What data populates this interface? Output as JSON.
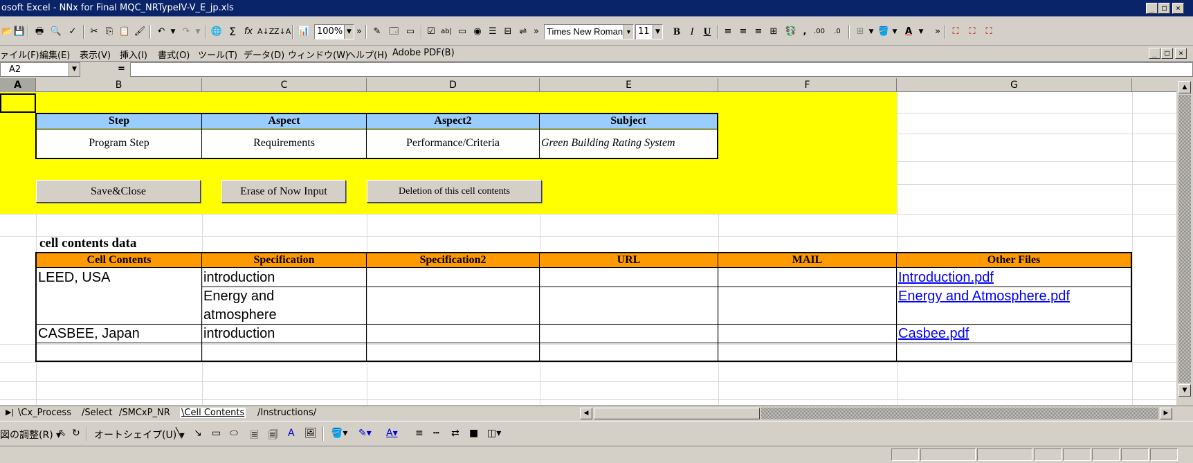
{
  "window": {
    "title": "osoft Excel - NNx for Final MQC_NRTypeIV-V_E_jp.xls",
    "min_label": "_",
    "max_label": "□",
    "close_label": "×"
  },
  "toolbar": {
    "zoom": "100%",
    "font_name": "Times New Roman",
    "font_size": "11",
    "bold": "B",
    "italic": "I",
    "underline": "U",
    "comma": ",",
    "inc_decimal": ".00",
    "dec_decimal": ".0",
    "sum": "Σ",
    "fx": "fx",
    "overflow": "»"
  },
  "menu": [
    "ァイル(F)",
    "編集(E)",
    "表示(V)",
    "挿入(I)",
    "書式(O)",
    "ツール(T)",
    "データ(D)",
    "ウィンドウ(W)",
    "ヘルプ(H)",
    "Adobe PDF(B)"
  ],
  "formula": {
    "cell_ref": "A2",
    "equals": "=",
    "value": ""
  },
  "columns": [
    "A",
    "B",
    "C",
    "D",
    "E",
    "F",
    "G"
  ],
  "header_table": {
    "headers": [
      "Step",
      "Aspect",
      "Aspect2",
      "Subject"
    ],
    "values": [
      "Program Step",
      "Requirements",
      "Performance/Criteria",
      "Green Building Rating System"
    ]
  },
  "buttons": {
    "save_close": "Save&Close",
    "erase": "Erase of Now Input",
    "delete": "Deletion of this cell contents"
  },
  "section_title": "cell contents data",
  "data_table": {
    "headers": [
      "Cell Contents",
      "Specification",
      "Specification2",
      "URL",
      "MAIL",
      "Other Files"
    ],
    "rows": [
      {
        "cell_contents": "LEED, USA",
        "specification": "introduction",
        "other_files": "Introduction.pdf"
      },
      {
        "cell_contents": "",
        "specification": "Energy and",
        "specification_cont": "atmosphere",
        "other_files": "Energy and Atmosphere.pdf"
      },
      {
        "cell_contents": "CASBEE, Japan",
        "specification": "introduction",
        "other_files": "Casbee.pdf"
      }
    ]
  },
  "sheet_tabs": [
    "Cx_Process",
    "Select",
    "SMCxP_NR",
    "Cell Contents",
    "Instructions"
  ],
  "active_tab": "Cell Contents",
  "drawing": {
    "draw_label": "図の調整(R)",
    "autoshape_label": "オートシェイプ(U)"
  },
  "colors": {
    "yellow": "#ffff00",
    "blue_header": "#99ccff",
    "orange_header": "#ff9900",
    "link": "#0000ff",
    "title_bar": "#0a246a"
  }
}
